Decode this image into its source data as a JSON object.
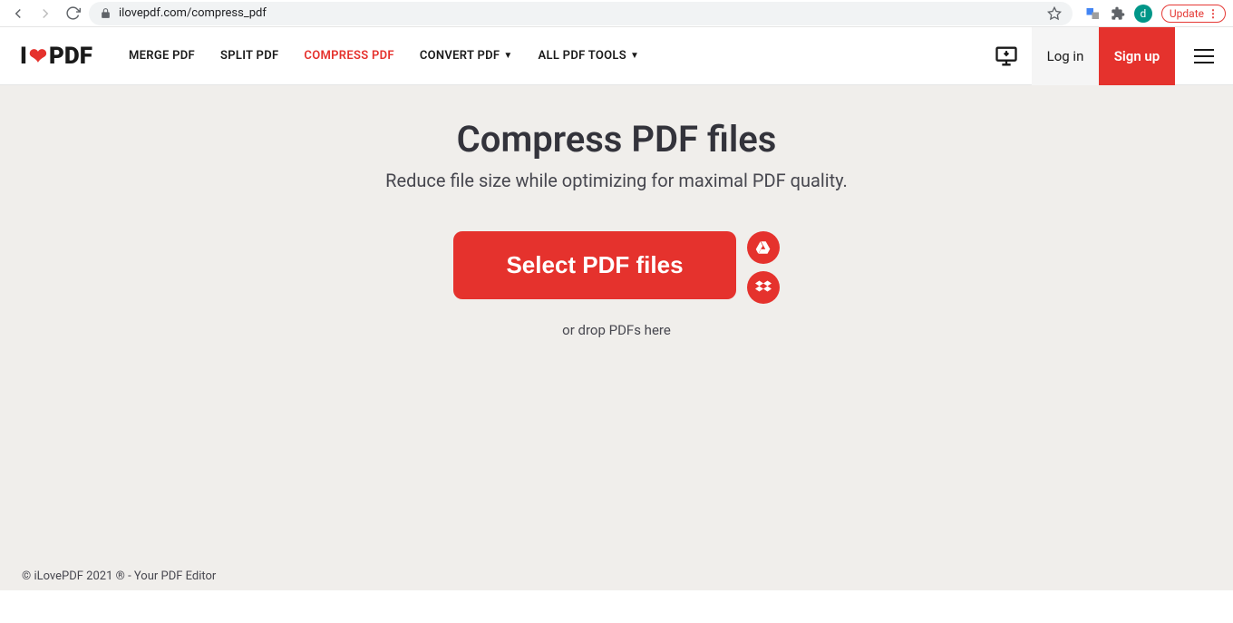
{
  "browser": {
    "url": "ilovepdf.com/compress_pdf",
    "update_label": "Update",
    "avatar_letter": "d"
  },
  "logo": {
    "left": "I",
    "right": "PDF"
  },
  "nav": {
    "merge": "MERGE PDF",
    "split": "SPLIT PDF",
    "compress": "COMPRESS PDF",
    "convert": "CONVERT PDF",
    "all": "ALL PDF TOOLS"
  },
  "header_right": {
    "login": "Log in",
    "signup": "Sign up"
  },
  "page": {
    "title": "Compress PDF files",
    "subtitle": "Reduce file size while optimizing for maximal PDF quality.",
    "select_label": "Select PDF files",
    "drop_hint": "or drop PDFs here"
  },
  "footer": {
    "text": "© iLovePDF 2021 ® - Your PDF Editor"
  }
}
